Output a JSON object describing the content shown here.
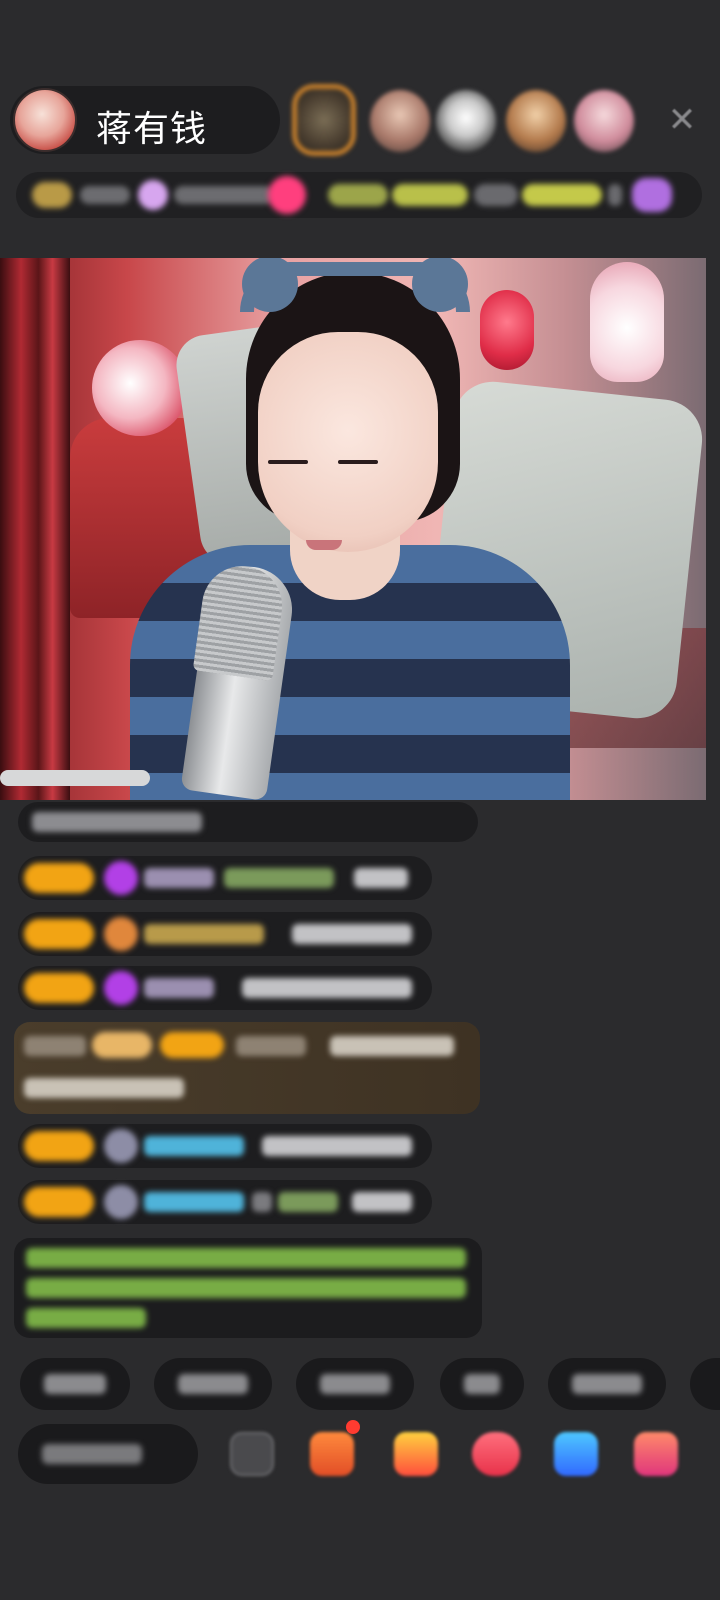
{
  "header": {
    "host_name": "蒋有钱",
    "close_glyph": "✕"
  },
  "icons": {
    "close": "close-icon",
    "host_avatar": "avatar",
    "emoji": "emoji-icon",
    "gift": "gift-icon"
  },
  "colors": {
    "background": "#2b2b2d",
    "level_badge": "#f2a414",
    "gem_purple": "#b240e6",
    "notice_green": "#8fd14f",
    "name_blue": "#4fb3d9"
  }
}
